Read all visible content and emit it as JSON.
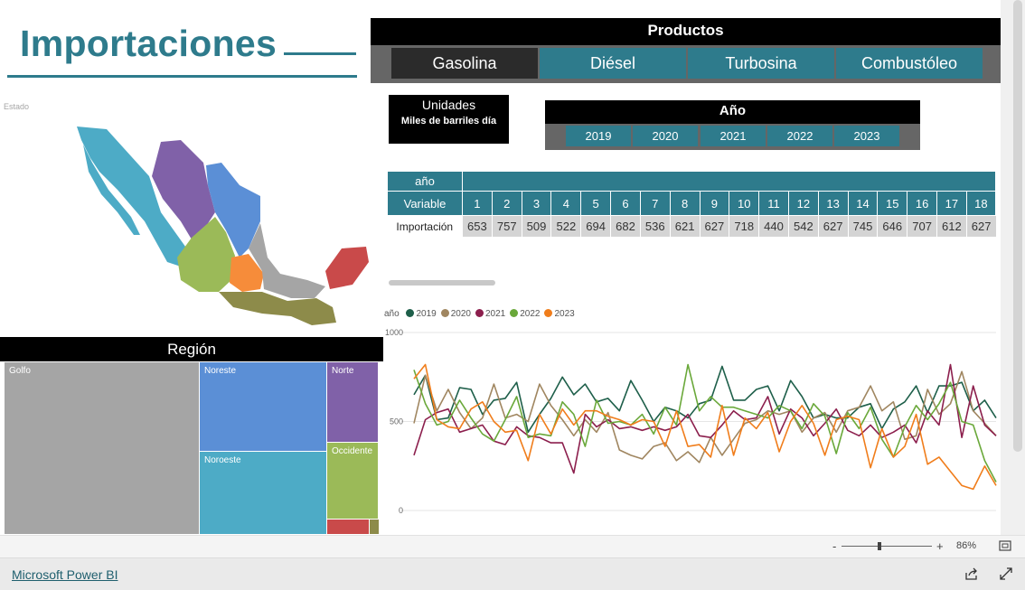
{
  "title": "Importaciones",
  "map": {
    "label": "Estado"
  },
  "region": {
    "header": "Región",
    "tiles": [
      {
        "name": "Golfo",
        "color": "#a5a5a5"
      },
      {
        "name": "Noreste",
        "color": "#5b8fd6"
      },
      {
        "name": "Norte",
        "color": "#8061a8"
      },
      {
        "name": "Noroeste",
        "color": "#4dabc6"
      },
      {
        "name": "Occidente",
        "color": "#9bba58"
      },
      {
        "name": "",
        "color": "#c94a4a"
      },
      {
        "name": "",
        "color": "#8d8b4a"
      }
    ]
  },
  "productos": {
    "header": "Productos",
    "tabs": [
      "Gasolina",
      "Diésel",
      "Turbosina",
      "Combustóleo"
    ],
    "selected": "Gasolina"
  },
  "units": {
    "line1": "Unidades",
    "line2": "Miles de barriles día"
  },
  "ano": {
    "header": "Año",
    "years": [
      "2019",
      "2020",
      "2021",
      "2022",
      "2023"
    ]
  },
  "matrix": {
    "corner_top": "año",
    "corner_bottom": "Variable",
    "row_label": "Importación",
    "columns": [
      "1",
      "2",
      "3",
      "4",
      "5",
      "6",
      "7",
      "8",
      "9",
      "10",
      "11",
      "12",
      "13",
      "14",
      "15",
      "16",
      "17",
      "18"
    ],
    "values": [
      "653",
      "757",
      "509",
      "522",
      "694",
      "682",
      "536",
      "621",
      "627",
      "718",
      "440",
      "542",
      "627",
      "745",
      "646",
      "707",
      "612",
      "627"
    ]
  },
  "chart_data": {
    "type": "line",
    "legend_title": "año",
    "legend_position": "top-left",
    "ylim": [
      0,
      1000
    ],
    "yticks": [
      "1000",
      "500",
      "0"
    ],
    "grid": true,
    "x": [
      1,
      2,
      3,
      4,
      5,
      6,
      7,
      8,
      9,
      10,
      11,
      12,
      13,
      14,
      15,
      16,
      17,
      18,
      19,
      20,
      21,
      22,
      23,
      24,
      25,
      26,
      27,
      28,
      29,
      30,
      31,
      32,
      33,
      34,
      35,
      36,
      37,
      38,
      39,
      40,
      41,
      42,
      43,
      44,
      45,
      46,
      47,
      48,
      49,
      50,
      51,
      52
    ],
    "series": [
      {
        "name": "2019",
        "color": "#1e5f4a",
        "values": [
          650,
          760,
          510,
          520,
          690,
          680,
          540,
          620,
          630,
          720,
          440,
          540,
          630,
          750,
          650,
          710,
          610,
          630,
          560,
          730,
          620,
          500,
          580,
          560,
          520,
          600,
          620,
          810,
          620,
          620,
          680,
          700,
          560,
          730,
          640,
          520,
          540,
          520,
          520,
          580,
          600,
          460,
          570,
          610,
          700,
          550,
          700,
          700,
          720,
          560,
          620,
          520
        ]
      },
      {
        "name": "2020",
        "color": "#a08660",
        "values": [
          490,
          760,
          560,
          680,
          550,
          460,
          520,
          710,
          520,
          540,
          500,
          710,
          590,
          510,
          420,
          510,
          440,
          550,
          340,
          310,
          290,
          360,
          380,
          280,
          330,
          270,
          410,
          310,
          400,
          490,
          510,
          560,
          540,
          560,
          440,
          520,
          550,
          440,
          560,
          580,
          700,
          560,
          610,
          400,
          420,
          680,
          540,
          600,
          780,
          560,
          490,
          420
        ]
      },
      {
        "name": "2021",
        "color": "#8c1f4d",
        "values": [
          310,
          510,
          550,
          570,
          440,
          460,
          480,
          390,
          370,
          470,
          420,
          410,
          380,
          380,
          210,
          540,
          470,
          510,
          460,
          470,
          450,
          470,
          450,
          470,
          540,
          420,
          410,
          480,
          560,
          510,
          520,
          640,
          430,
          570,
          520,
          420,
          490,
          570,
          450,
          420,
          480,
          410,
          440,
          480,
          380,
          560,
          480,
          820,
          410,
          700,
          480,
          420
        ]
      },
      {
        "name": "2022",
        "color": "#6aa83a",
        "values": [
          790,
          600,
          480,
          500,
          620,
          520,
          430,
          390,
          510,
          640,
          410,
          430,
          420,
          610,
          540,
          360,
          620,
          490,
          500,
          480,
          540,
          430,
          580,
          480,
          820,
          560,
          640,
          580,
          580,
          560,
          540,
          520,
          590,
          560,
          460,
          600,
          530,
          320,
          550,
          460,
          580,
          400,
          300,
          470,
          590,
          510,
          600,
          720,
          500,
          480,
          280,
          160
        ]
      },
      {
        "name": "2023",
        "color": "#f07d1b",
        "values": [
          740,
          820,
          510,
          470,
          460,
          570,
          610,
          500,
          440,
          450,
          280,
          540,
          430,
          570,
          480,
          560,
          560,
          530,
          510,
          480,
          510,
          500,
          360,
          560,
          360,
          370,
          300,
          590,
          310,
          520,
          460,
          550,
          330,
          500,
          590,
          490,
          310,
          510,
          530,
          510,
          240,
          460,
          300,
          360,
          540,
          260,
          300,
          220,
          140,
          120,
          250,
          140
        ]
      }
    ]
  },
  "zoom": {
    "level": "86%",
    "minus": "-",
    "plus": "+"
  },
  "footer": {
    "link": "Microsoft Power BI"
  }
}
